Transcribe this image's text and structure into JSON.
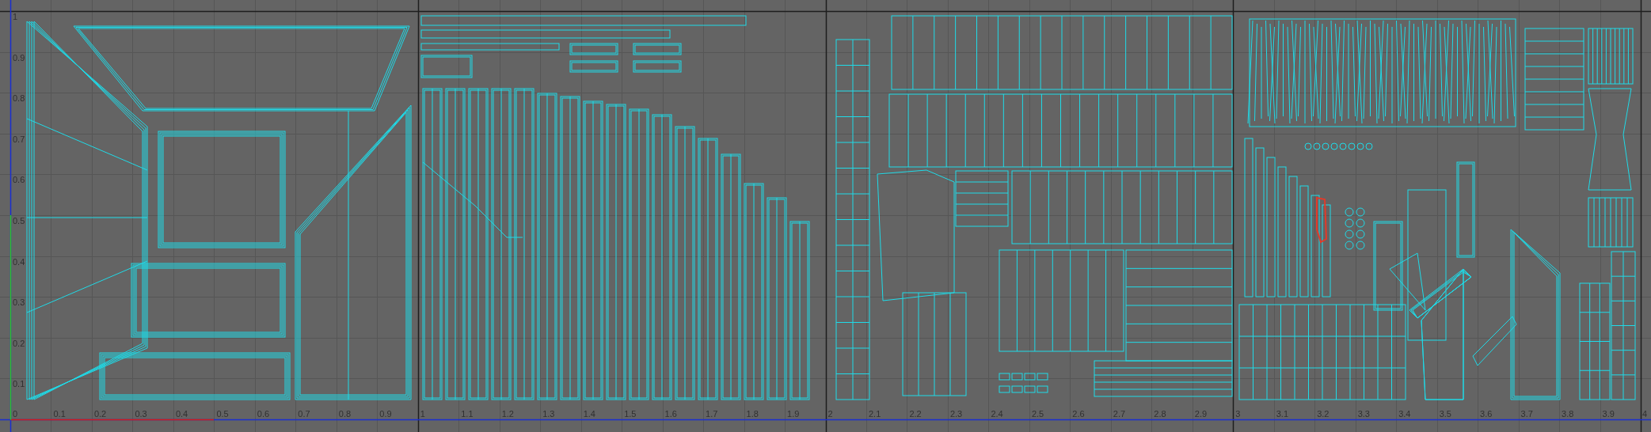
{
  "uv_editor": {
    "v_axis_labels": [
      "1",
      "0.9",
      "0.8",
      "0.7",
      "0.6",
      "0.5",
      "0.4",
      "0.3",
      "0.2",
      "0.1",
      "0"
    ],
    "u_axis_labels": [
      "0.1",
      "0.2",
      "0.3",
      "0.4",
      "0.5",
      "0.6",
      "0.7",
      "0.8",
      "0.9",
      "1",
      "1.1",
      "1.2",
      "1.3",
      "1.4",
      "1.5",
      "1.6",
      "1.7",
      "1.8",
      "1.9",
      "2",
      "2.1",
      "2.2",
      "2.3",
      "2.4",
      "2.5",
      "2.6",
      "2.7",
      "2.8",
      "2.9",
      "3",
      "3.1",
      "3.2",
      "3.3",
      "3.4",
      "3.5",
      "3.6",
      "3.7",
      "3.8",
      "3.9",
      "4"
    ]
  }
}
